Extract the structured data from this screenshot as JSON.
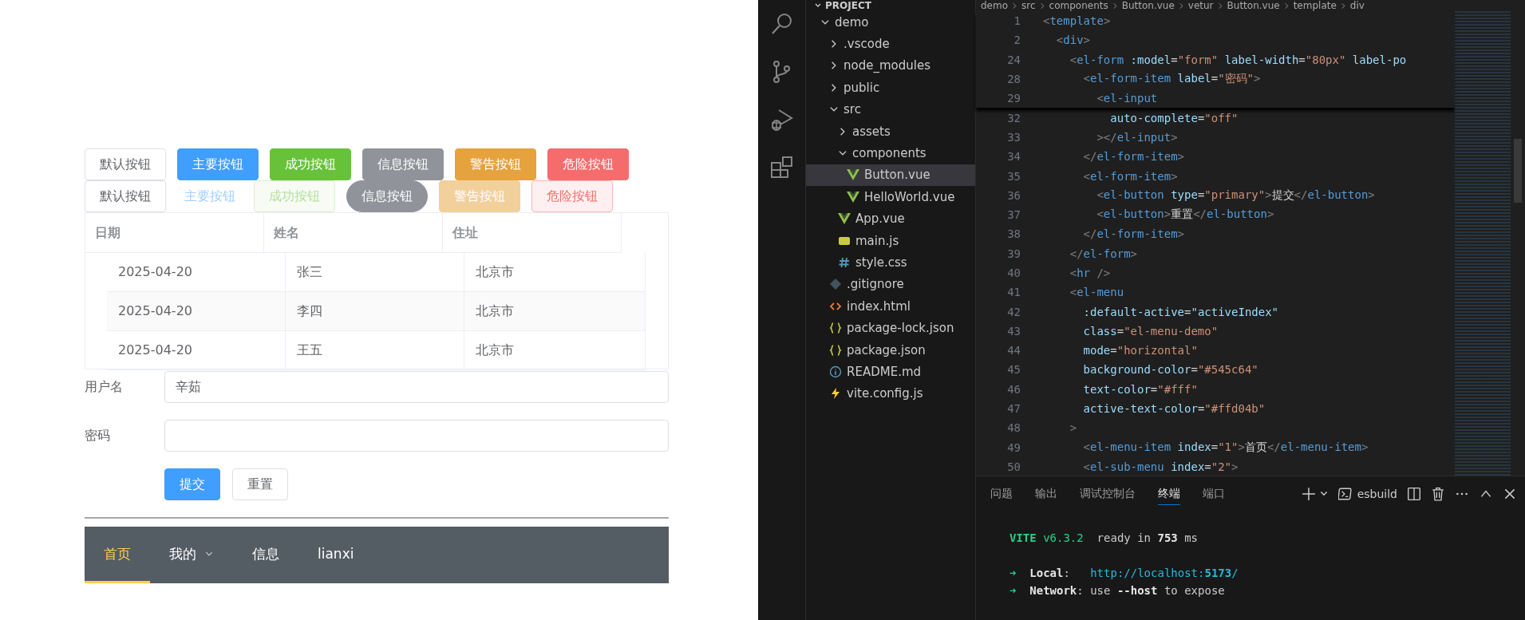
{
  "app": {
    "button_rows": [
      [
        {
          "label": "默认按钮",
          "kind": "default",
          "disabled": false
        },
        {
          "label": "主要按钮",
          "kind": "primary",
          "disabled": false
        },
        {
          "label": "成功按钮",
          "kind": "success",
          "disabled": false
        },
        {
          "label": "信息按钮",
          "kind": "info",
          "disabled": false
        },
        {
          "label": "警告按钮",
          "kind": "warning",
          "disabled": false
        },
        {
          "label": "危险按钮",
          "kind": "danger",
          "disabled": false
        }
      ],
      [
        {
          "label": "默认按钮",
          "kind": "default",
          "disabled": false
        },
        {
          "label": "主要按钮",
          "kind": "text",
          "disabled": true
        },
        {
          "label": "成功按钮",
          "kind": "successplain",
          "disabled": true
        },
        {
          "label": "信息按钮",
          "kind": "inforound",
          "disabled": false
        },
        {
          "label": "警告按钮",
          "kind": "warning",
          "disabled": true
        },
        {
          "label": "危险按钮",
          "kind": "dangerplain",
          "disabled": false
        }
      ]
    ],
    "table": {
      "columns": [
        "日期",
        "姓名",
        "住址"
      ],
      "rows": [
        [
          "2025-04-20",
          "张三",
          "北京市"
        ],
        [
          "2025-04-20",
          "李四",
          "北京市"
        ],
        [
          "2025-04-20",
          "王五",
          "北京市"
        ]
      ]
    },
    "form": {
      "fields": [
        {
          "label": "用户名",
          "value": "辛茹"
        },
        {
          "label": "密码"
        }
      ],
      "buttons": [
        {
          "label": "提交",
          "kind": "primary"
        },
        {
          "label": "重置",
          "kind": "default"
        }
      ]
    },
    "menu": {
      "items": [
        {
          "label": "首页",
          "kind": "item",
          "selected": true
        },
        {
          "label": "我的",
          "kind": "submenu",
          "selected": false
        },
        {
          "label": "信息",
          "kind": "item",
          "selected": false
        },
        {
          "label": "lianxi",
          "kind": "item",
          "selected": false
        }
      ]
    }
  },
  "explorer": {
    "header": "PROJECT",
    "tree": [
      {
        "label": "demo",
        "kind": "folder",
        "expanded": true,
        "selected": false,
        "children": [
          {
            "label": ".vscode",
            "kind": "folder",
            "expanded": false,
            "selected": false
          },
          {
            "label": "node_modules",
            "kind": "folder",
            "expanded": false,
            "selected": false
          },
          {
            "label": "public",
            "kind": "folder",
            "expanded": false,
            "selected": false
          },
          {
            "label": "src",
            "kind": "folder",
            "expanded": true,
            "selected": false,
            "children": [
              {
                "label": "assets",
                "kind": "folder",
                "expanded": false,
                "selected": false
              },
              {
                "label": "components",
                "kind": "folder",
                "expanded": true,
                "selected": false,
                "children": [
                  {
                    "label": "Button.vue",
                    "kind": "vue",
                    "selected": true
                  },
                  {
                    "label": "HelloWorld.vue",
                    "kind": "vue",
                    "selected": false
                  }
                ]
              },
              {
                "label": "App.vue",
                "kind": "vue",
                "selected": false
              },
              {
                "label": "main.js",
                "kind": "js",
                "selected": false
              },
              {
                "label": "style.css",
                "kind": "css",
                "selected": false
              }
            ]
          },
          {
            "label": ".gitignore",
            "kind": "git",
            "selected": false
          },
          {
            "label": "index.html",
            "kind": "html",
            "selected": false
          },
          {
            "label": "package-lock.json",
            "kind": "json",
            "selected": false
          },
          {
            "label": "package.json",
            "kind": "json",
            "selected": false
          },
          {
            "label": "README.md",
            "kind": "info",
            "selected": false
          },
          {
            "label": "vite.config.js",
            "kind": "vite",
            "selected": false
          }
        ]
      }
    ]
  },
  "editor": {
    "breadcrumb": [
      "demo",
      "src",
      "components",
      "Button.vue",
      "vetur",
      "Button.vue",
      "template",
      "div"
    ],
    "sticky_lines": [
      {
        "num": "1",
        "tokens": [
          {
            "kind": "b",
            "text": "<"
          },
          {
            "kind": "tag",
            "text": "template"
          },
          {
            "kind": "b",
            "text": ">"
          }
        ]
      },
      {
        "num": "2",
        "tokens": [
          {
            "kind": "b",
            "text": "  <"
          },
          {
            "kind": "tag",
            "text": "div"
          },
          {
            "kind": "b",
            "text": ">"
          }
        ]
      },
      {
        "num": "24",
        "tokens": [
          {
            "kind": "b",
            "text": "    <"
          },
          {
            "kind": "tag",
            "text": "el-form"
          },
          {
            "kind": "attr",
            "text": " :model"
          },
          {
            "kind": "p",
            "text": "="
          },
          {
            "kind": "str",
            "text": "\"form\""
          },
          {
            "kind": "attr",
            "text": " label-width"
          },
          {
            "kind": "p",
            "text": "="
          },
          {
            "kind": "str",
            "text": "\"80px\""
          },
          {
            "kind": "attr",
            "text": " label-po"
          }
        ]
      },
      {
        "num": "28",
        "tokens": [
          {
            "kind": "b",
            "text": "      <"
          },
          {
            "kind": "tag",
            "text": "el-form-item"
          },
          {
            "kind": "attr",
            "text": " label"
          },
          {
            "kind": "p",
            "text": "="
          },
          {
            "kind": "str",
            "text": "\"密码\""
          },
          {
            "kind": "b",
            "text": ">"
          }
        ]
      },
      {
        "num": "29",
        "tokens": [
          {
            "kind": "b",
            "text": "        <"
          },
          {
            "kind": "tag",
            "text": "el-input"
          }
        ]
      }
    ],
    "lines": [
      {
        "num": "32",
        "tokens": [
          {
            "kind": "attr",
            "text": "          auto-complete"
          },
          {
            "kind": "p",
            "text": "="
          },
          {
            "kind": "str",
            "text": "\"off\""
          }
        ]
      },
      {
        "num": "33",
        "tokens": [
          {
            "kind": "b",
            "text": "        ></"
          },
          {
            "kind": "tag",
            "text": "el-input"
          },
          {
            "kind": "b",
            "text": ">"
          }
        ]
      },
      {
        "num": "34",
        "tokens": [
          {
            "kind": "b",
            "text": "      </"
          },
          {
            "kind": "tag",
            "text": "el-form-item"
          },
          {
            "kind": "b",
            "text": ">"
          }
        ]
      },
      {
        "num": "35",
        "tokens": [
          {
            "kind": "b",
            "text": "      <"
          },
          {
            "kind": "tag",
            "text": "el-form-item"
          },
          {
            "kind": "b",
            "text": ">"
          }
        ]
      },
      {
        "num": "36",
        "tokens": [
          {
            "kind": "b",
            "text": "        <"
          },
          {
            "kind": "tag",
            "text": "el-button"
          },
          {
            "kind": "attr",
            "text": " type"
          },
          {
            "kind": "p",
            "text": "="
          },
          {
            "kind": "str",
            "text": "\"primary\""
          },
          {
            "kind": "b",
            "text": ">"
          },
          {
            "kind": "txt",
            "text": "提交"
          },
          {
            "kind": "b",
            "text": "</"
          },
          {
            "kind": "tag",
            "text": "el-button"
          },
          {
            "kind": "b",
            "text": ">"
          }
        ]
      },
      {
        "num": "37",
        "tokens": [
          {
            "kind": "b",
            "text": "        <"
          },
          {
            "kind": "tag",
            "text": "el-button"
          },
          {
            "kind": "b",
            "text": ">"
          },
          {
            "kind": "txt",
            "text": "重置"
          },
          {
            "kind": "b",
            "text": "</"
          },
          {
            "kind": "tag",
            "text": "el-button"
          },
          {
            "kind": "b",
            "text": ">"
          }
        ]
      },
      {
        "num": "38",
        "tokens": [
          {
            "kind": "b",
            "text": "      </"
          },
          {
            "kind": "tag",
            "text": "el-form-item"
          },
          {
            "kind": "b",
            "text": ">"
          }
        ]
      },
      {
        "num": "39",
        "tokens": [
          {
            "kind": "b",
            "text": "    </"
          },
          {
            "kind": "tag",
            "text": "el-form"
          },
          {
            "kind": "b",
            "text": ">"
          }
        ]
      },
      {
        "num": "40",
        "tokens": [
          {
            "kind": "b",
            "text": "    <"
          },
          {
            "kind": "tag",
            "text": "hr"
          },
          {
            "kind": "b",
            "text": " />"
          }
        ]
      },
      {
        "num": "41",
        "tokens": [
          {
            "kind": "b",
            "text": "    <"
          },
          {
            "kind": "tag",
            "text": "el-menu"
          }
        ]
      },
      {
        "num": "42",
        "tokens": [
          {
            "kind": "attr",
            "text": "      :default-active"
          },
          {
            "kind": "p",
            "text": "="
          },
          {
            "kind": "str2",
            "text": "\"activeIndex\""
          }
        ]
      },
      {
        "num": "43",
        "tokens": [
          {
            "kind": "attr",
            "text": "      class"
          },
          {
            "kind": "p",
            "text": "="
          },
          {
            "kind": "str",
            "text": "\"el-menu-demo\""
          }
        ]
      },
      {
        "num": "44",
        "tokens": [
          {
            "kind": "attr",
            "text": "      mode"
          },
          {
            "kind": "p",
            "text": "="
          },
          {
            "kind": "str",
            "text": "\"horizontal\""
          }
        ]
      },
      {
        "num": "45",
        "tokens": [
          {
            "kind": "attr",
            "text": "      background-color"
          },
          {
            "kind": "p",
            "text": "="
          },
          {
            "kind": "str",
            "text": "\"#545c64\""
          }
        ]
      },
      {
        "num": "46",
        "tokens": [
          {
            "kind": "attr",
            "text": "      text-color"
          },
          {
            "kind": "p",
            "text": "="
          },
          {
            "kind": "str",
            "text": "\"#fff\""
          }
        ]
      },
      {
        "num": "47",
        "tokens": [
          {
            "kind": "attr",
            "text": "      active-text-color"
          },
          {
            "kind": "p",
            "text": "="
          },
          {
            "kind": "str",
            "text": "\"#ffd04b\""
          }
        ]
      },
      {
        "num": "48",
        "tokens": [
          {
            "kind": "b",
            "text": "    >"
          }
        ]
      },
      {
        "num": "49",
        "tokens": [
          {
            "kind": "b",
            "text": "      <"
          },
          {
            "kind": "tag",
            "text": "el-menu-item"
          },
          {
            "kind": "attr",
            "text": " index"
          },
          {
            "kind": "p",
            "text": "="
          },
          {
            "kind": "str",
            "text": "\"1\""
          },
          {
            "kind": "b",
            "text": ">"
          },
          {
            "kind": "txt",
            "text": "首页"
          },
          {
            "kind": "b",
            "text": "</"
          },
          {
            "kind": "tag",
            "text": "el-menu-item"
          },
          {
            "kind": "b",
            "text": ">"
          }
        ]
      },
      {
        "num": "50",
        "tokens": [
          {
            "kind": "b",
            "text": "      <"
          },
          {
            "kind": "tag",
            "text": "el-sub-menu"
          },
          {
            "kind": "attr",
            "text": " index"
          },
          {
            "kind": "p",
            "text": "="
          },
          {
            "kind": "str",
            "text": "\"2\""
          },
          {
            "kind": "b",
            "text": ">"
          }
        ]
      }
    ]
  },
  "panel": {
    "tabs": [
      {
        "label": "问题",
        "selected": false
      },
      {
        "label": "输出",
        "selected": false
      },
      {
        "label": "调试控制台",
        "selected": false
      },
      {
        "label": "终端",
        "selected": true
      },
      {
        "label": "端口",
        "selected": false
      }
    ],
    "terminal_profile": "esbuild",
    "terminal": [
      [
        {
          "kind": "vite",
          "text": "VITE"
        },
        {
          "kind": "green",
          "text": " v6.3.2"
        },
        {
          "kind": "plain",
          "text": "  ready in "
        },
        {
          "kind": "bold",
          "text": "753"
        },
        {
          "kind": "plain",
          "text": " ms"
        }
      ],
      [
        {
          "kind": "arrow",
          "text": "➜"
        },
        {
          "kind": "bold",
          "text": "  Local"
        },
        {
          "kind": "plain",
          "text": ":   "
        },
        {
          "kind": "url",
          "text": "http://localhost:"
        },
        {
          "kind": "urlbold",
          "text": "5173"
        },
        {
          "kind": "url",
          "text": "/"
        }
      ],
      [
        {
          "kind": "arrow",
          "text": "➜"
        },
        {
          "kind": "bold",
          "text": "  Network"
        },
        {
          "kind": "plain",
          "text": ": use "
        },
        {
          "kind": "bold",
          "text": "--host"
        },
        {
          "kind": "plain",
          "text": " to expose"
        }
      ]
    ]
  }
}
